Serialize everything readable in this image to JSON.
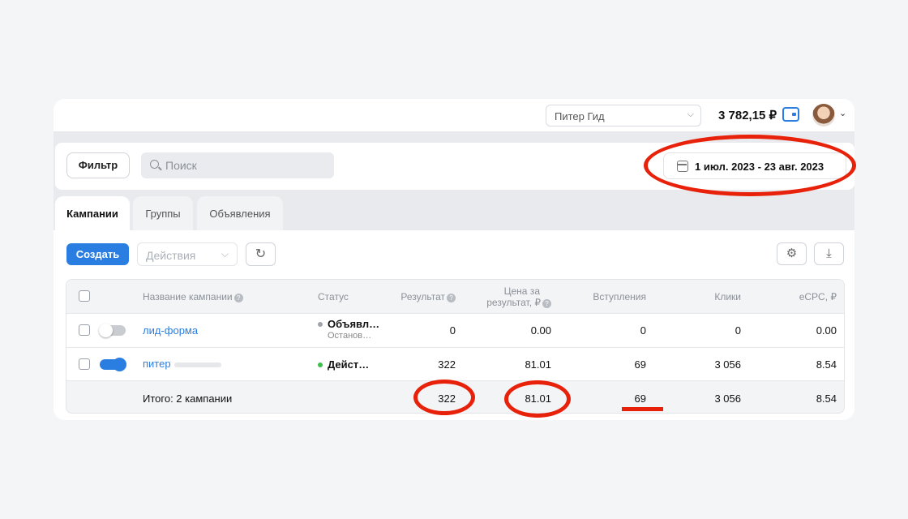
{
  "topbar": {
    "account": "Питер Гид",
    "balance": "3 782,15 ₽"
  },
  "filter": {
    "filter_label": "Фильтр",
    "search_placeholder": "Поиск",
    "date_range": "1 июл. 2023 - 23 авг. 2023"
  },
  "tabs": [
    {
      "label": "Кампании",
      "active": true
    },
    {
      "label": "Группы",
      "active": false
    },
    {
      "label": "Объявления",
      "active": false
    }
  ],
  "toolbar": {
    "create_label": "Создать",
    "actions_placeholder": "Действия"
  },
  "table": {
    "headers": {
      "name": "Название кампании",
      "status": "Статус",
      "result": "Результат",
      "price_line1": "Цена за",
      "price_line2": "результат, ₽",
      "joins": "Вступления",
      "clicks": "Клики",
      "ecpc": "eCPC, ₽"
    },
    "rows": [
      {
        "name": "лид-форма",
        "enabled": false,
        "status": "Объявл…",
        "status_sub": "Останов…",
        "status_color": "#9ea3aa",
        "result": "0",
        "price": "0.00",
        "joins": "0",
        "clicks": "0",
        "ecpc": "0.00"
      },
      {
        "name": "питер",
        "enabled": true,
        "status": "Дейст…",
        "status_sub": "",
        "status_color": "#3bbf4a",
        "result": "322",
        "price": "81.01",
        "joins": "69",
        "clicks": "3 056",
        "ecpc": "8.54"
      }
    ],
    "total": {
      "label": "Итого: 2 кампании",
      "result": "322",
      "price": "81.01",
      "joins": "69",
      "clicks": "3 056",
      "ecpc": "8.54"
    }
  },
  "colors": {
    "accent": "#2a7de1",
    "annotation": "#e8220a"
  }
}
